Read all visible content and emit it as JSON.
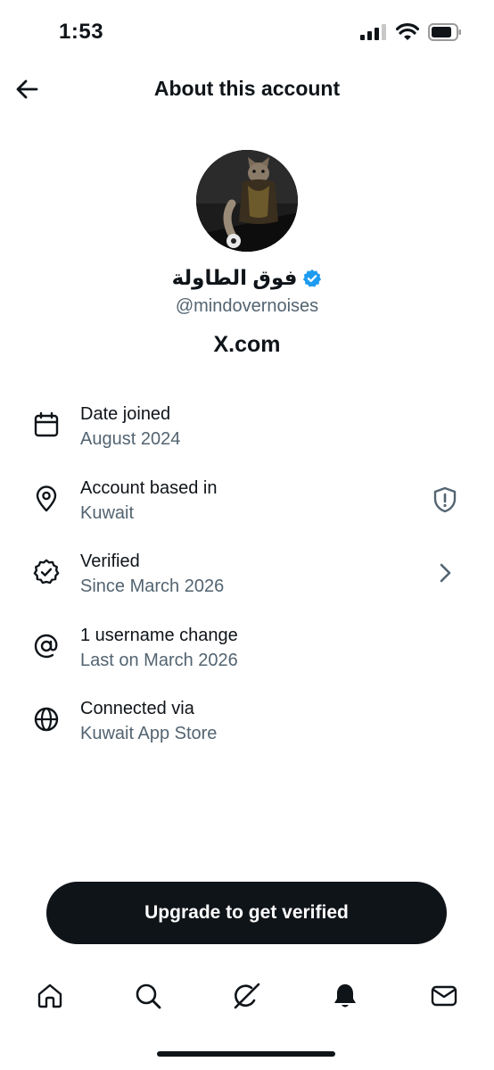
{
  "status_bar": {
    "time": "1:53"
  },
  "header": {
    "title": "About this account"
  },
  "profile": {
    "display_name": "فوق الطاولة",
    "handle": "@mindovernoises",
    "domain": "X.com",
    "verified_badge_color": "#1d9bf0"
  },
  "info_items": [
    {
      "icon": "calendar-icon",
      "title": "Date joined",
      "subtitle": "August 2024"
    },
    {
      "icon": "location-pin-icon",
      "title": "Account based in",
      "subtitle": "Kuwait",
      "trailing": "shield-alert-icon"
    },
    {
      "icon": "verified-badge-outline-icon",
      "title": "Verified",
      "subtitle": "Since March 2026",
      "trailing": "chevron-right-icon"
    },
    {
      "icon": "at-sign-icon",
      "title": "1 username change",
      "subtitle": "Last on March 2026"
    },
    {
      "icon": "globe-icon",
      "title": "Connected via",
      "subtitle": "Kuwait App Store"
    }
  ],
  "upgrade_button": {
    "label": "Upgrade to get verified"
  },
  "tab_bar": [
    "home-icon",
    "search-icon",
    "grok-icon",
    "notifications-bell-icon",
    "messages-icon"
  ],
  "colors": {
    "text_primary": "#0f1419",
    "text_secondary": "#536471",
    "button_bg": "#0f1419"
  }
}
